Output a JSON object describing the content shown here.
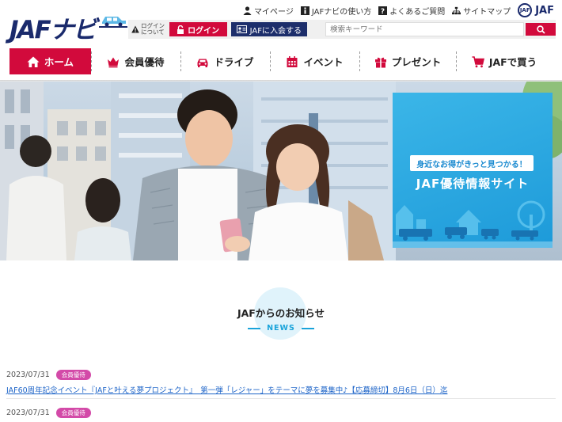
{
  "brand": {
    "logo_text": "JAFナビ",
    "org_text": "JAF",
    "seal_text": "JAF"
  },
  "utility": [
    {
      "label": "マイページ",
      "icon": "person-icon"
    },
    {
      "label": "JAFナビの使い方",
      "icon": "info-icon"
    },
    {
      "label": "よくあるご質問",
      "icon": "question-icon"
    },
    {
      "label": "サイトマップ",
      "icon": "sitemap-icon"
    }
  ],
  "login_bar": {
    "about_login": "ログイン\nについて",
    "login_label": "ログイン",
    "join_label": "JAFに入会する",
    "search_placeholder": "検索キーワード"
  },
  "nav": [
    {
      "label": "ホーム",
      "icon": "home-icon",
      "active": true
    },
    {
      "label": "会員優待",
      "icon": "crown-icon",
      "active": false
    },
    {
      "label": "ドライブ",
      "icon": "car-icon",
      "active": false
    },
    {
      "label": "イベント",
      "icon": "calendar-icon",
      "active": false
    },
    {
      "label": "プレゼント",
      "icon": "gift-icon",
      "active": false
    },
    {
      "label": "JAFで買う",
      "icon": "cart-icon",
      "active": false
    }
  ],
  "hero": {
    "tagline": "身近なお得がきっと見つかる！",
    "title": "JAF優待情報サイト"
  },
  "news": {
    "title": "JAFからのお知らせ",
    "subtitle": "NEWS",
    "items": [
      {
        "date": "2023/07/31",
        "badge": "会員優待",
        "text": "JAF60周年記念イベント『JAFと叶える夢プロジェクト』　第一弾「レジャー」をテーマに夢を募集中♪【応募締切】8月6日（日）迄"
      },
      {
        "date": "2023/07/31",
        "badge": "会員優待"
      }
    ]
  },
  "colors": {
    "primary_red": "#d20a3c",
    "navy": "#1d2e6b",
    "accent_blue": "#19a3da",
    "badge_pink": "#d34aa8"
  }
}
